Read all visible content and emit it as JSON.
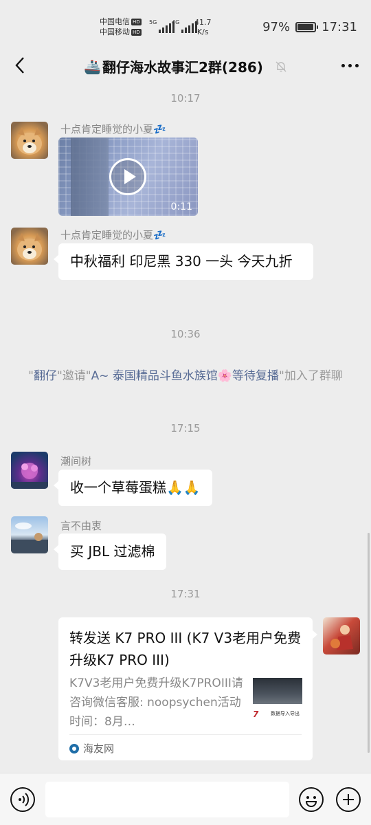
{
  "status_bar": {
    "carrier1": "中国电信",
    "carrier2": "中国移动",
    "hd_badge": "HD",
    "signal1_label": "5G",
    "signal2_label": "4G",
    "speed_value": "41.7",
    "speed_unit": "K/s",
    "battery_percent": "97%",
    "battery_level": 0.97,
    "clock": "17:31"
  },
  "header": {
    "title_icon": "🚢",
    "title": "翻仔海水故事汇2群(286)",
    "mute_icon": "bell-off-icon",
    "more_icon": "more-dots-icon"
  },
  "messages": {
    "time1": "10:17",
    "msg1_sender": "十点肯定睡觉的小夏💤",
    "msg1_video_duration": "0:11",
    "msg2_sender": "十点肯定睡觉的小夏💤",
    "msg2_text": "中秋福利  印尼黑 330 一头  今天九折",
    "time2": "10:36",
    "sys_q1": "\"",
    "sys_inviter": "翻仔",
    "sys_q2": "\"邀请\"",
    "sys_invitee": "A~ 泰国精品斗鱼水族馆🌸等待复播",
    "sys_q3": "\"加入了群聊",
    "time3": "17:15",
    "msg3_sender": "潮间树",
    "msg3_text": "收一个草莓蛋糕🙏🙏",
    "msg4_sender": "言不由衷",
    "msg4_text": "买 JBL 过滤棉",
    "time4": "17:31",
    "share_title": "转发送 K7 PRO III (K7 V3老用户免费升级K7 PRO III)",
    "share_desc": "K7V3老用户免费升级K7PROIII请咨询微信客服: noopsychen活动时间：8月…",
    "share_thumb_logo": "7",
    "share_thumb_caption": "数据导入导出",
    "share_source": "海友网"
  },
  "input_bar": {
    "placeholder": "",
    "voice_icon": "voice-icon",
    "emoji_icon": "emoji-icon",
    "plus_icon": "plus-icon"
  }
}
